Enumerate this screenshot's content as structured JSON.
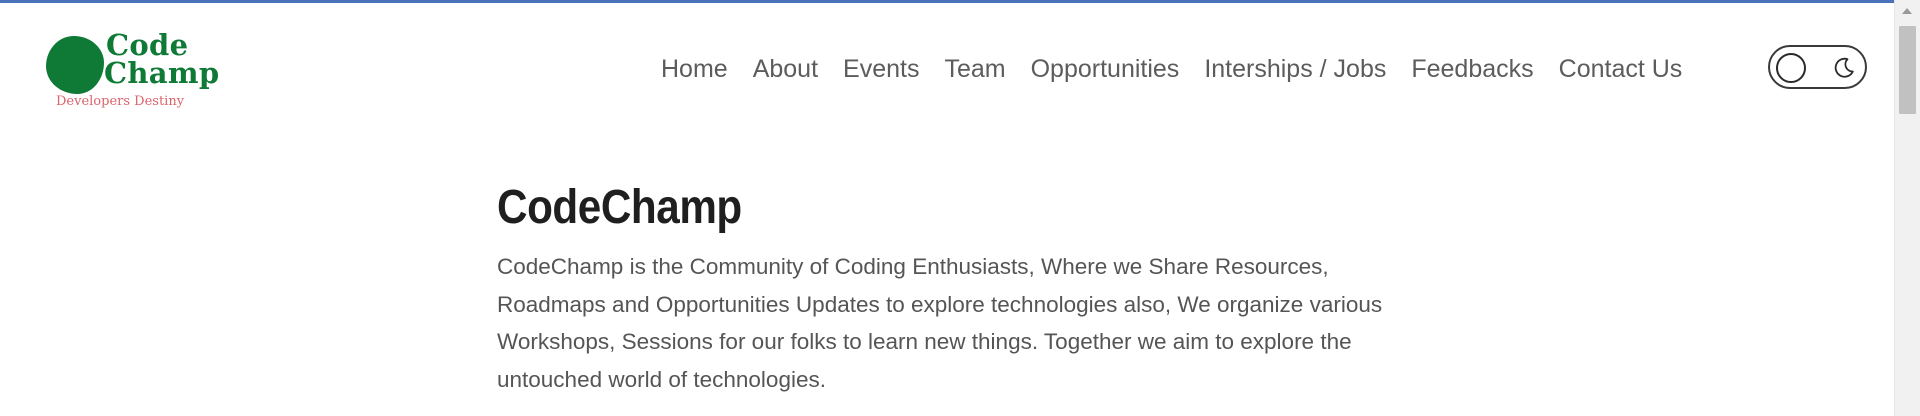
{
  "brand": {
    "line1": "Code",
    "line2": "Champ",
    "tagline": "Developers Destiny",
    "primary_color": "#0f7a36",
    "tagline_color": "#d9636a"
  },
  "nav": {
    "items": [
      {
        "label": "Home"
      },
      {
        "label": "About"
      },
      {
        "label": "Events"
      },
      {
        "label": "Team"
      },
      {
        "label": "Opportunities"
      },
      {
        "label": "Interships / Jobs"
      },
      {
        "label": "Feedbacks"
      },
      {
        "label": "Contact Us"
      }
    ]
  },
  "theme_toggle": {
    "light_icon": "circle-icon",
    "dark_icon": "moon-icon"
  },
  "hero": {
    "title": "CodeChamp",
    "description": "CodeChamp is the Community of Coding Enthusiasts, Where we Share Resources, Roadmaps and Opportunities Updates to explore technologies also, We organize various Workshops, Sessions for our folks to learn new things. Together we aim to explore the untouched world of technologies."
  }
}
